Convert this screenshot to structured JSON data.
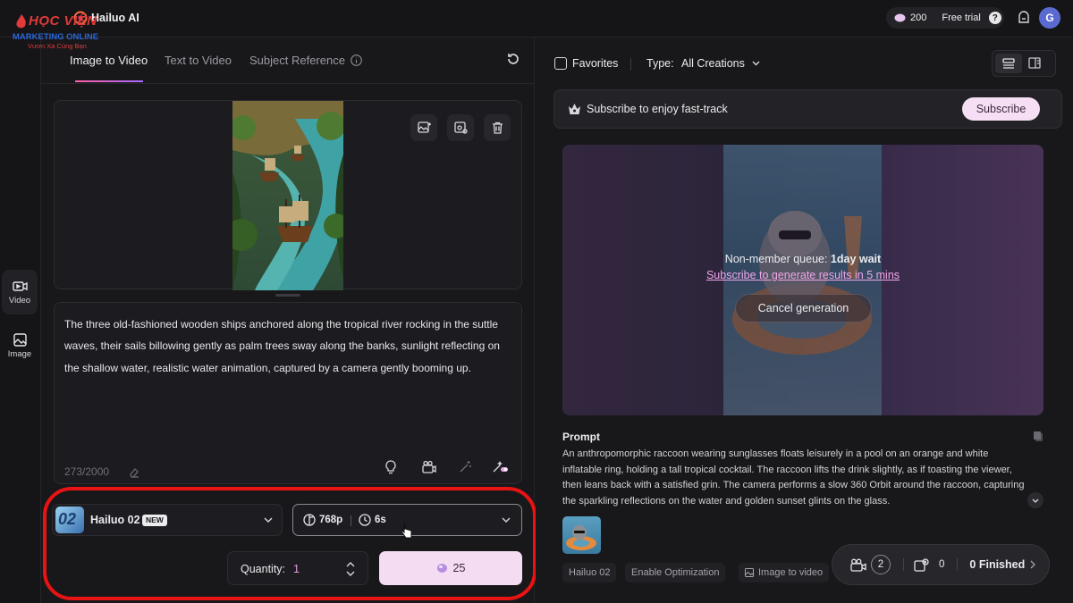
{
  "watermark": {
    "line1": "HỌC VIỆN",
    "line2": "MARKETING ONLINE",
    "line3": "Vươn Xa Cùng Bạn"
  },
  "app": {
    "name": "Hailuo AI"
  },
  "header": {
    "credits": "200",
    "plan": "Free trial",
    "avatar_letter": "G"
  },
  "rail": [
    {
      "label": "Video"
    },
    {
      "label": "Image"
    }
  ],
  "tabs": [
    {
      "label": "Image to Video"
    },
    {
      "label": "Text to Video"
    },
    {
      "label": "Subject Reference"
    }
  ],
  "prompt": {
    "text": "The three old-fashioned wooden ships anchored along the tropical river rocking in the suttle waves, their sails billowing gently as palm trees sway along the banks, sunlight reflecting on the shallow water, realistic water animation, captured by a camera gently booming up.",
    "char_count": "273/2000"
  },
  "settings": {
    "model_name": "Hailuo 02",
    "model_badge": "NEW",
    "model_thumb_text": "02",
    "resolution": "768p",
    "duration": "6s",
    "quantity_label": "Quantity:",
    "quantity_value": "1",
    "generate_cost": "25"
  },
  "filters": {
    "favorites_label": "Favorites",
    "type_label": "Type:",
    "type_value": "All Creations"
  },
  "subscribe_bar": {
    "text": "Subscribe to enjoy fast-track",
    "button": "Subscribe"
  },
  "video_card": {
    "queue_text": "Non-member queue: ",
    "queue_wait": "1day wait",
    "subscribe_link": "Subscribe to generate results in 5 mins",
    "cancel_button": "Cancel generation"
  },
  "result": {
    "prompt_heading": "Prompt",
    "prompt_text": "An anthropomorphic raccoon wearing sunglasses floats leisurely in a pool on an orange and white inflatable ring, holding a tall tropical cocktail. The raccoon lifts the drink slightly, as if toasting the viewer, then leans back with a satisfied grin. The camera performs a slow 360 Orbit around the raccoon, capturing the sparkling reflections on the water and golden sunset glints on the glass.",
    "tags": [
      "Hailuo 02",
      "Enable Optimization",
      "Image to video"
    ]
  },
  "status": {
    "processing_count": "2",
    "queued_count": "0",
    "finished": "0 Finished"
  },
  "colors": {
    "accent": "#f4dcf2",
    "highlight_ring": "#e81313",
    "background": "#18181b"
  }
}
